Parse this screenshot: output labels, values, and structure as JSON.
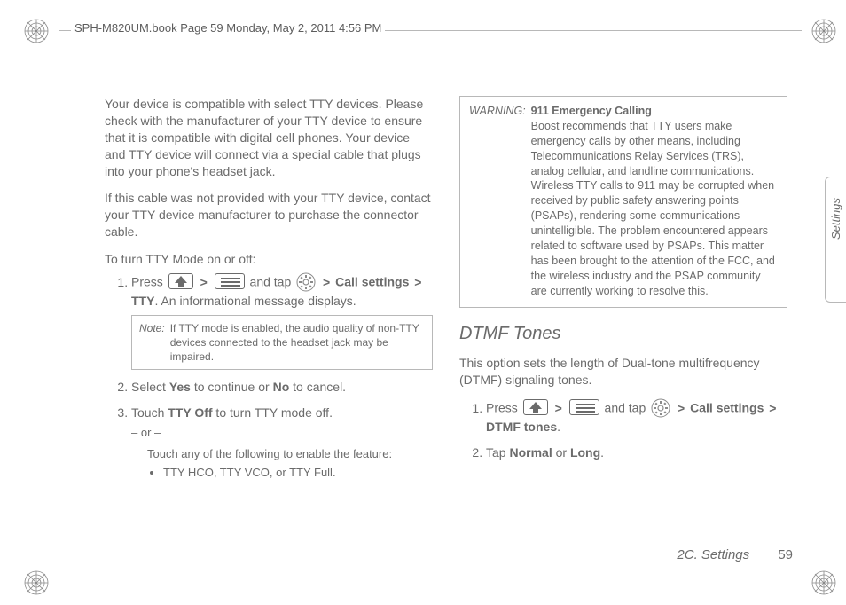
{
  "header": {
    "running_head": "SPH-M820UM.book  Page 59  Monday, May 2, 2011  4:56 PM"
  },
  "side_tab": {
    "label": "Settings"
  },
  "left": {
    "p1": "Your device is compatible with select TTY devices. Please check with the manufacturer of your TTY device to ensure that it is compatible with digital cell phones. Your device and TTY device will connect via a special cable that plugs into your phone's headset jack.",
    "p2": "If this cable was not provided with your TTY device, contact your TTY device manufacturer to purchase the connector cable.",
    "subhead": "To turn TTY Mode on or off:",
    "step1_a": "Press ",
    "sep": ">",
    "step1_b": " and tap ",
    "step1_c": "Call settings",
    "step1_d": "TTY",
    "step1_e": ". An informational message displays.",
    "note_label": "Note:",
    "note_body": "If TTY mode is enabled, the audio quality of non-TTY devices connected to the headset jack may be impaired.",
    "step2_a": "Select ",
    "step2_yes": "Yes",
    "step2_b": " to continue or ",
    "step2_no": "No",
    "step2_c": " to cancel.",
    "step3_a": "Touch ",
    "step3_ttyoff": "TTY Off",
    "step3_b": " to turn TTY mode off.",
    "ordash": "– or –",
    "step3_sub": "Touch any of the following to enable the feature:",
    "bullet1": "TTY HCO, TTY VCO, or TTY Full."
  },
  "right": {
    "warn_label": "WARNING:",
    "warn_title": "911 Emergency Calling",
    "warn_body": "Boost recommends that TTY users make emergency calls by other means, including Telecommunications Relay Services (TRS), analog cellular, and landline communications. Wireless TTY calls to 911 may be corrupted when received by public safety answering points (PSAPs), rendering some communications unintelligible. The problem encountered appears related to software used by PSAPs. This matter has been brought to the attention of the FCC, and the wireless industry and the PSAP community are currently working to resolve this.",
    "h2": "DTMF Tones",
    "p1": "This option sets the length of Dual-tone multifrequency (DTMF) signaling tones.",
    "step1_a": "Press ",
    "sep": ">",
    "step1_b": " and tap ",
    "step1_c": "Call settings",
    "step1_d": "DTMF tones",
    "step1_e": ".",
    "step2_a": "Tap ",
    "step2_normal": "Normal",
    "step2_b": " or ",
    "step2_long": "Long",
    "step2_c": "."
  },
  "footer": {
    "section": "2C. Settings",
    "page": "59"
  }
}
